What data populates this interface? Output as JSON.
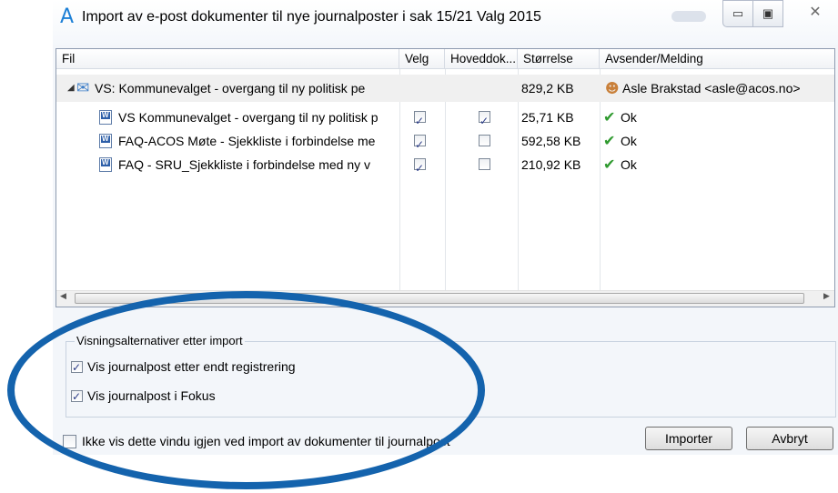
{
  "window": {
    "title": "Import av e-post dokumenter til nye journalposter i sak 15/21 Valg 2015",
    "app_icon": "A",
    "controls": {
      "minimize_icon": "minimize-icon",
      "maximize_icon": "maximize-icon",
      "close_icon": "close-icon"
    }
  },
  "table": {
    "columns": [
      "Fil",
      "Velg",
      "Hoveddok...",
      "Størrelse",
      "Avsender/Melding"
    ],
    "parent_row": {
      "file": "VS: Kommunevalget - overgang til ny politisk pe",
      "size": "829,2 KB",
      "sender": "Asle Brakstad <asle@acos.no>"
    },
    "rows": [
      {
        "file": "VS Kommunevalget - overgang til ny politisk p",
        "velg": true,
        "hoveddok": true,
        "size": "25,71 KB",
        "status": "Ok"
      },
      {
        "file": "FAQ-ACOS Møte - Sjekkliste i forbindelse me",
        "velg": true,
        "hoveddok": false,
        "size": "592,58 KB",
        "status": "Ok"
      },
      {
        "file": "FAQ - SRU_Sjekkliste i forbindelse med ny v",
        "velg": true,
        "hoveddok": false,
        "size": "210,92 KB",
        "status": "Ok"
      }
    ]
  },
  "options": {
    "group_label": "Visningsalternativer etter import",
    "vis_etter_registrering": {
      "label": "Vis journalpost etter endt registrering",
      "checked": true
    },
    "vis_i_fokus": {
      "label": "Vis journalpost i Fokus",
      "checked": true
    }
  },
  "footer": {
    "ikke_vis_label": "Ikke vis dette vindu igjen ved import av dokumenter til journalpost",
    "ikke_vis_checked": false,
    "import_button": "Importer",
    "cancel_button": "Avbryt"
  },
  "colors": {
    "annotation": "#1463ad",
    "ok": "#2f9a2f",
    "app_icon": "#1c7fd6"
  }
}
